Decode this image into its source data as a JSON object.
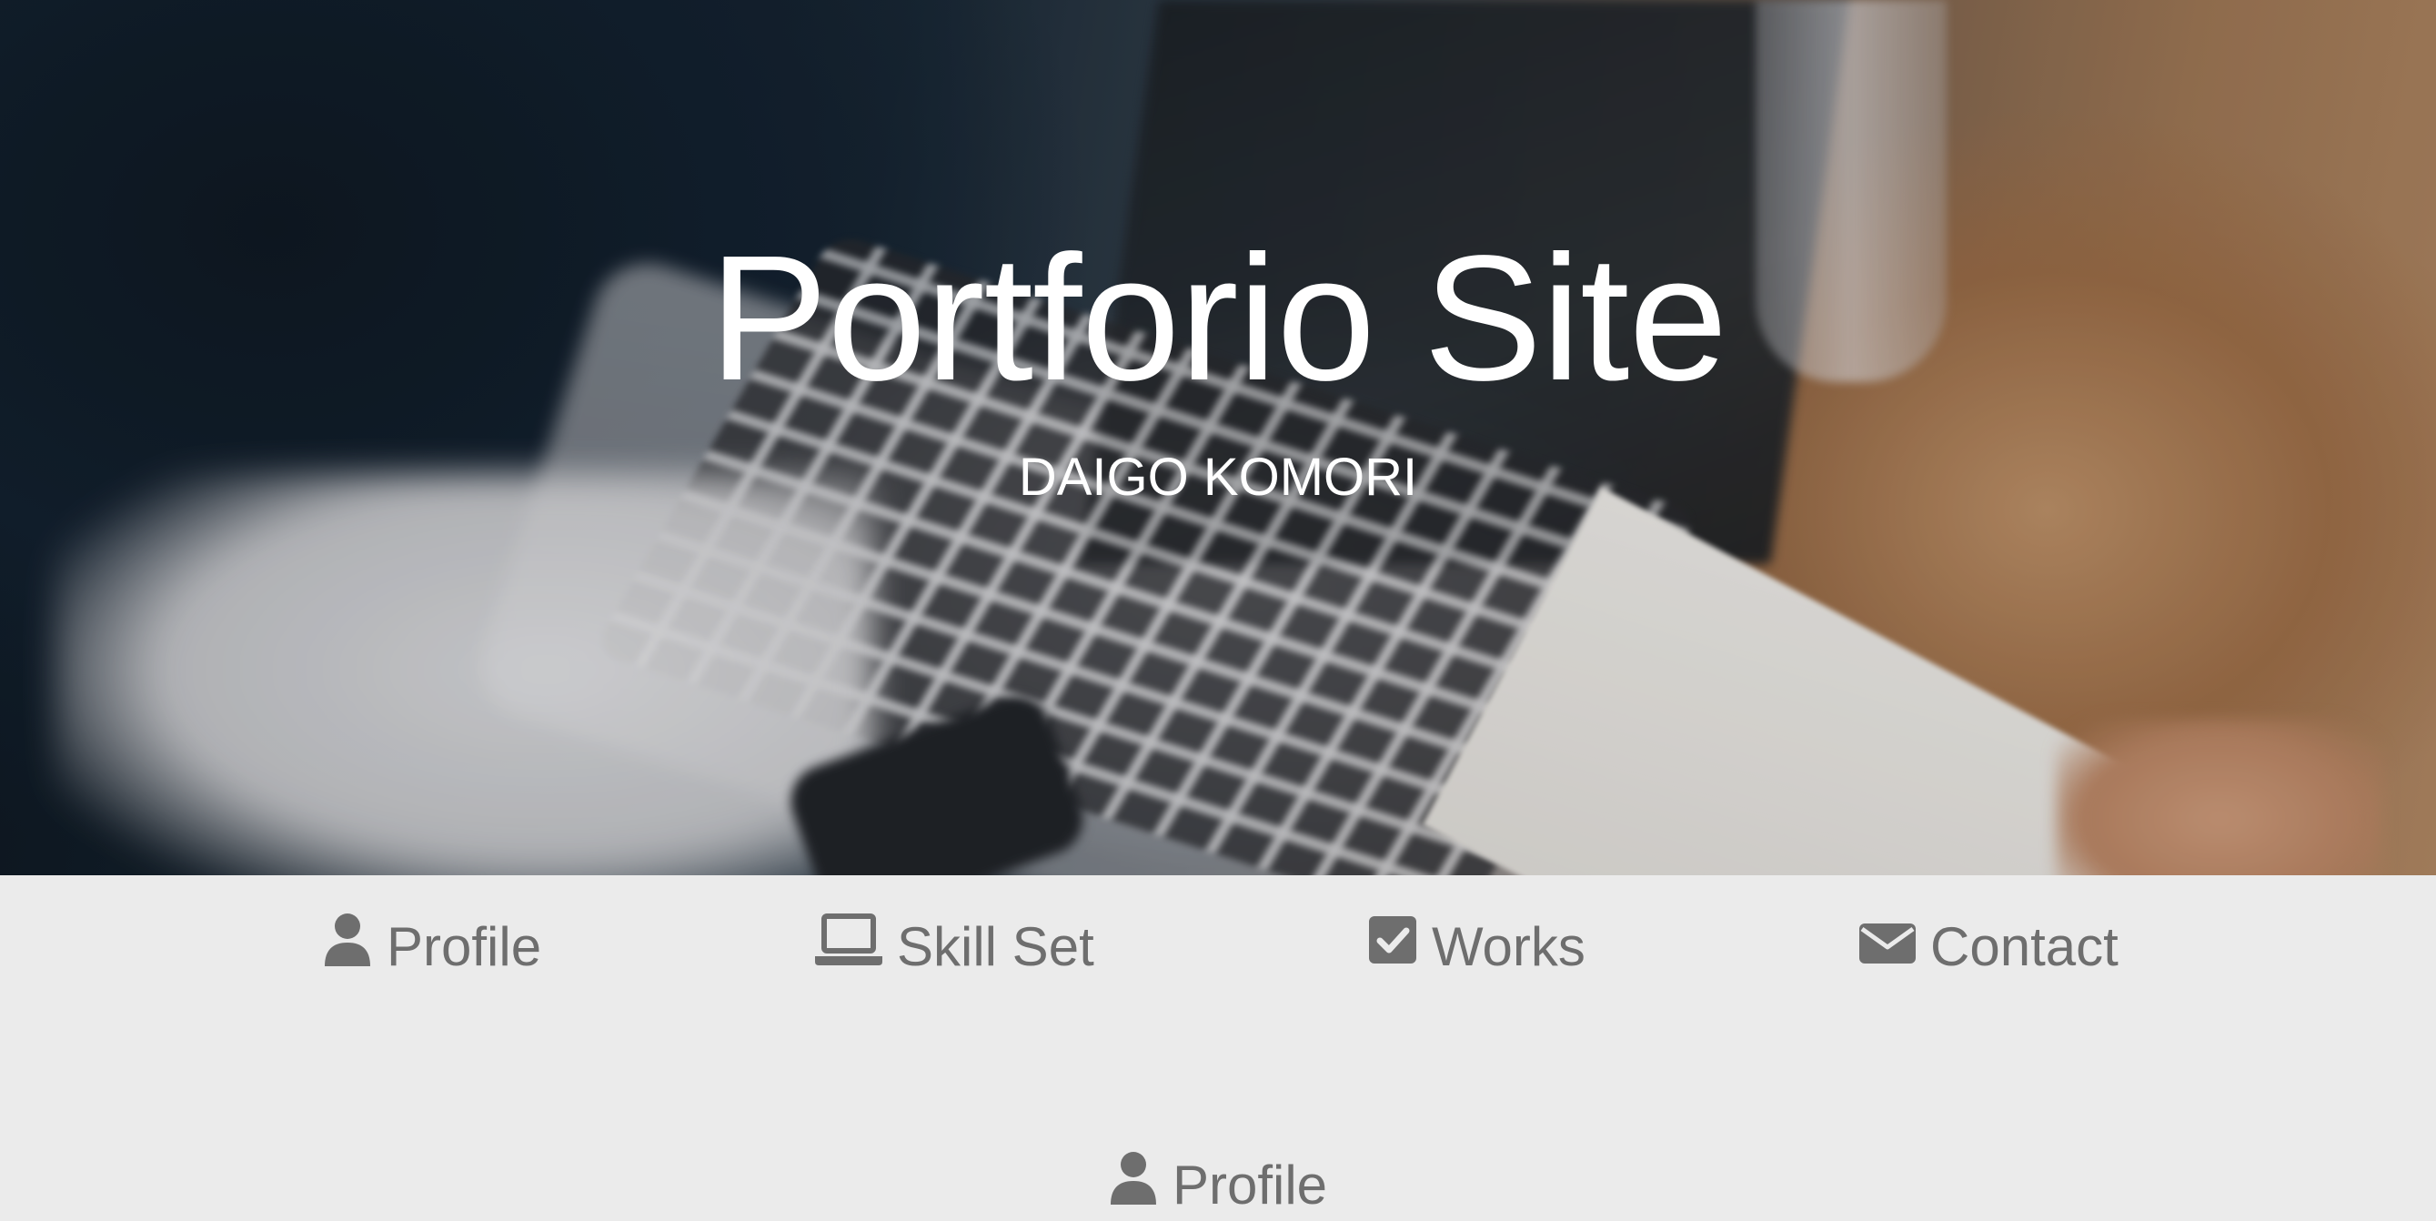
{
  "hero": {
    "title": "Portforio Site",
    "subtitle": "DAIGO KOMORI"
  },
  "nav": {
    "items": [
      {
        "label": "Profile",
        "icon": "user-icon"
      },
      {
        "label": "Skill Set",
        "icon": "laptop-icon"
      },
      {
        "label": "Works",
        "icon": "check-square-icon"
      },
      {
        "label": "Contact",
        "icon": "envelope-icon"
      }
    ]
  },
  "section": {
    "heading": "Profile",
    "icon": "user-icon"
  },
  "colors": {
    "background": "#ebebeb",
    "nav_text": "#6e6e6e",
    "hero_text": "#ffffff"
  }
}
